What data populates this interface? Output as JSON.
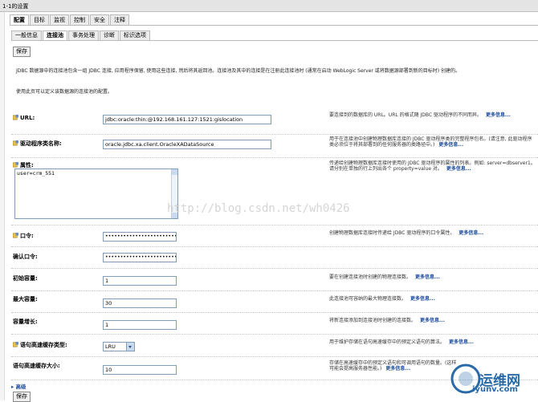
{
  "window": {
    "title": "1-1的设置"
  },
  "tabs": [
    "配置",
    "目标",
    "监视",
    "控制",
    "安全",
    "注释"
  ],
  "subtabs": [
    "一般信息",
    "连接池",
    "事务处理",
    "诊断",
    "标识选项"
  ],
  "buttons": {
    "save": "保存"
  },
  "intro": {
    "line1": "JDBC 数据源中的连接池包含一组 JDBC 连接, 应用程序保留, 使用这些连接, 然后将其返回池。连接池及其中的连接是在注册此连接池时 (通常在启动 WebLogic Server 或将数据源部署到新的目标时) 创建的。",
    "line2": "使用此页可以定义该数据源的连接池的配置。"
  },
  "more": "更多信息...",
  "fields": {
    "url": {
      "label": "URL:",
      "value": "jdbc:oracle:thin:@192.168.161.127:1521:gislocation",
      "desc": "要连接到的数据库的 URL。URL 的格式随 JDBC 驱动程序的不同而异。"
    },
    "driver": {
      "label": "驱动程序类名称:",
      "value": "oracle.jdbc.xa.client.OracleXADataSource",
      "desc": "用于在连接池中创建物理数据库连接的 JDBC 驱动程序类的完整程序包名。(请注意, 此驱动程序类必须位于将其部署到的任何服务器的类路径中。)"
    },
    "properties": {
      "label": "属性:",
      "value": "user=crm_551",
      "desc": "传递给创建物理数据库连接时使用的 JDBC 驱动程序的属性的列表。例如: server=dbserver1。请分别在单独的行上列出各个 property=value 对。"
    },
    "password": {
      "label": "口令:",
      "value": "••••••••••••••••••••••••••",
      "desc": "创建物理数据库连接时传递给 JDBC 驱动程序的口令属性。"
    },
    "confirm": {
      "label": "确认口令:",
      "value": "••••••••••••••••••••••••••"
    },
    "initial": {
      "label": "初始容量:",
      "value": "1",
      "desc": "要在创建连接池时创建的物理连接数。"
    },
    "max": {
      "label": "最大容量:",
      "value": "30",
      "desc": "此连接池可容纳的最大物理连接数。"
    },
    "increment": {
      "label": "容量增长:",
      "value": "1",
      "desc": "将新连接添加到连接池时创建的连接数。"
    },
    "cache_type": {
      "label": "语句高速缓存类型:",
      "value": "LRU",
      "desc": "用于维护存储在语句高速缓存中的预定义语句的算法。"
    },
    "cache_size": {
      "label": "语句高速缓存大小:",
      "value": "10",
      "desc": "存储在高速缓存中的预定义语句和可调用语句的数量。(这样可能会提高服务器性能。)"
    }
  },
  "advanced": "高级",
  "watermark": "http://blog.csdn.net/wh0426",
  "logo": {
    "name": "运维网",
    "domain": "iyunv.com"
  },
  "colors": {
    "link": "#1a4a9c",
    "input_border": "#7f9db9",
    "logo": "#2a6aa8"
  }
}
